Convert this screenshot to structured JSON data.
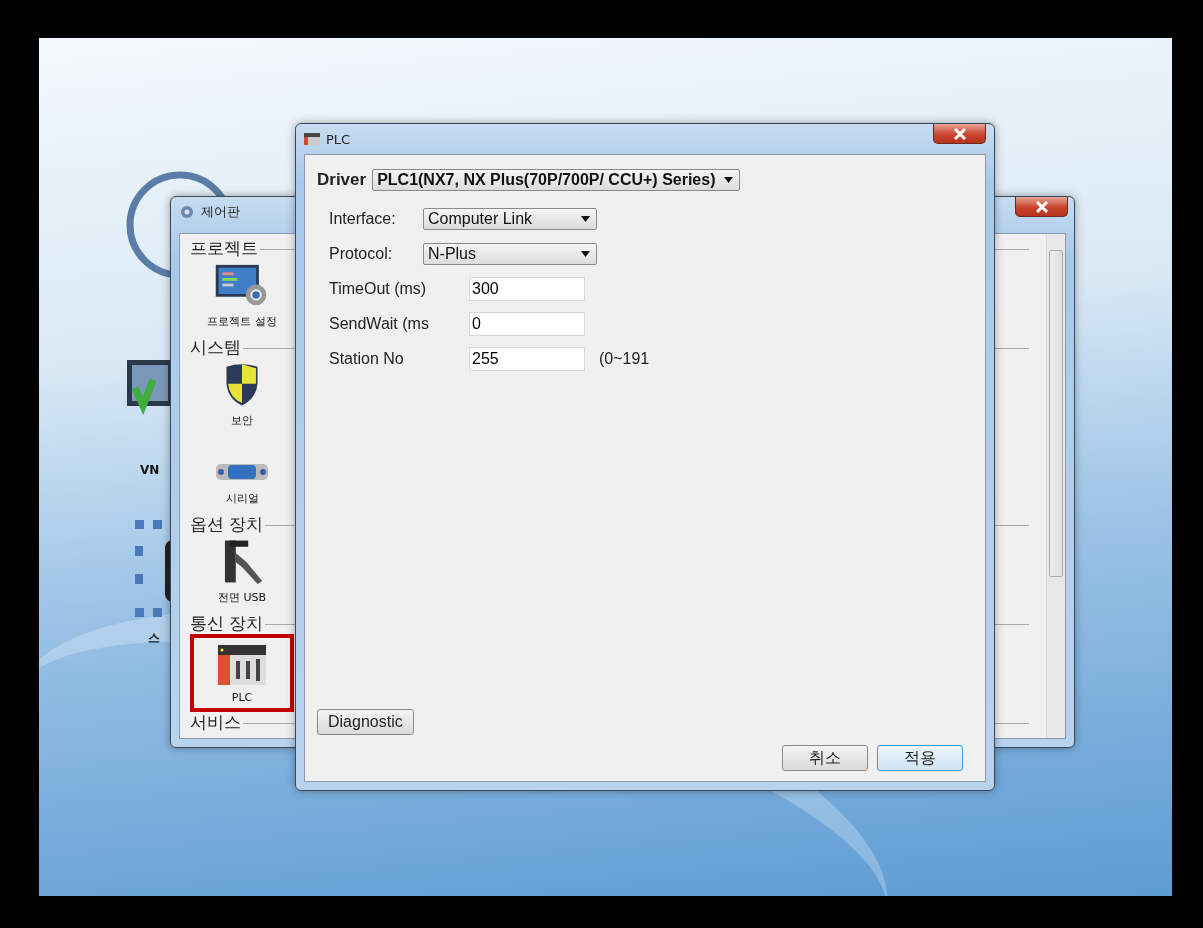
{
  "desktop": {
    "icons": [
      {
        "kind": "circle",
        "label": "VN"
      },
      {
        "kind": "squares",
        "label": "스"
      }
    ]
  },
  "control_panel": {
    "title": "제어판",
    "sections": [
      {
        "label": "프로젝트",
        "items": [
          {
            "kind": "settings",
            "label": "프로젝트 설정",
            "selected": false
          }
        ]
      },
      {
        "label": "시스템",
        "items": [
          {
            "kind": "shield",
            "label": "보안",
            "selected": false
          },
          {
            "kind": "serial",
            "label": "시리얼",
            "selected": false
          }
        ]
      },
      {
        "label": "옵션 장치",
        "items": [
          {
            "kind": "usb",
            "label": "전면 USB",
            "selected": false
          }
        ]
      },
      {
        "label": "통신 장치",
        "items": [
          {
            "kind": "plc",
            "label": "PLC",
            "selected": true
          }
        ]
      },
      {
        "label": "서비스"
      }
    ]
  },
  "plc_dialog": {
    "title": "PLC",
    "driver": {
      "label": "Driver",
      "value": "PLC1(NX7, NX Plus(70P/700P/ CCU+) Series)"
    },
    "fields": [
      {
        "kind": "select",
        "label": "Interface:",
        "value": "Computer Link"
      },
      {
        "kind": "select",
        "label": "Protocol:",
        "value": "N-Plus"
      },
      {
        "kind": "input",
        "label": "TimeOut (ms)",
        "value": "300"
      },
      {
        "kind": "input",
        "label": "SendWait (ms",
        "value": "0"
      },
      {
        "kind": "input",
        "label": "Station No",
        "value": "255",
        "note": "(0~191"
      }
    ],
    "diagnostic": {
      "label": "Diagnostic"
    },
    "buttons": [
      {
        "label": "취소",
        "default": false
      },
      {
        "label": "적용",
        "default": true
      }
    ]
  }
}
